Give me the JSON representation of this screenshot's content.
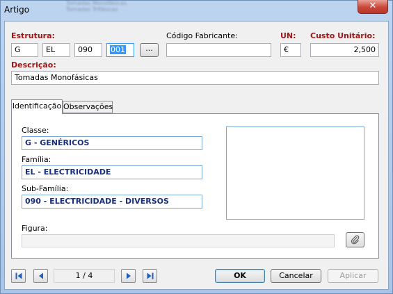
{
  "window": {
    "title": "Artigo",
    "close_glyph": "✕"
  },
  "background_text": [
    "Tomadas Monofásicas",
    "Tomadas Trifásicas"
  ],
  "estrutura": {
    "label": "Estrutura:",
    "values": [
      "G",
      "EL",
      "090",
      "001"
    ],
    "browse_label": "..."
  },
  "codigo_fabricante": {
    "label": "Código Fabricante:",
    "value": ""
  },
  "un": {
    "label": "UN:",
    "value": "€"
  },
  "custo_unitario": {
    "label": "Custo Unitário:",
    "value": "2,500"
  },
  "descricao": {
    "label": "Descrição:",
    "value": "Tomadas Monofásicas"
  },
  "tabs": [
    {
      "label": "Identificação",
      "active": true
    },
    {
      "label": "Observações",
      "active": false
    }
  ],
  "identificacao": {
    "classe_label": "Classe:",
    "classe_value": "G - GENÉRICOS",
    "familia_label": "Família:",
    "familia_value": "EL - ELECTRICIDADE",
    "subfamilia_label": "Sub-Família:",
    "subfamilia_value": "090 - ELECTRICIDADE - DIVERSOS",
    "figura_label": "Figura:",
    "figura_value": ""
  },
  "navigation": {
    "record_position": "1 / 4"
  },
  "buttons": {
    "ok": "OK",
    "cancel": "Cancelar",
    "apply": "Aplicar"
  },
  "colors": {
    "required_label": "#a31515",
    "value_text": "#1a2e80",
    "selection": "#3399ff"
  },
  "icons": {
    "attach": "paperclip-icon",
    "first": "first-record-icon",
    "prev": "previous-record-icon",
    "next": "next-record-icon",
    "last": "last-record-icon"
  }
}
